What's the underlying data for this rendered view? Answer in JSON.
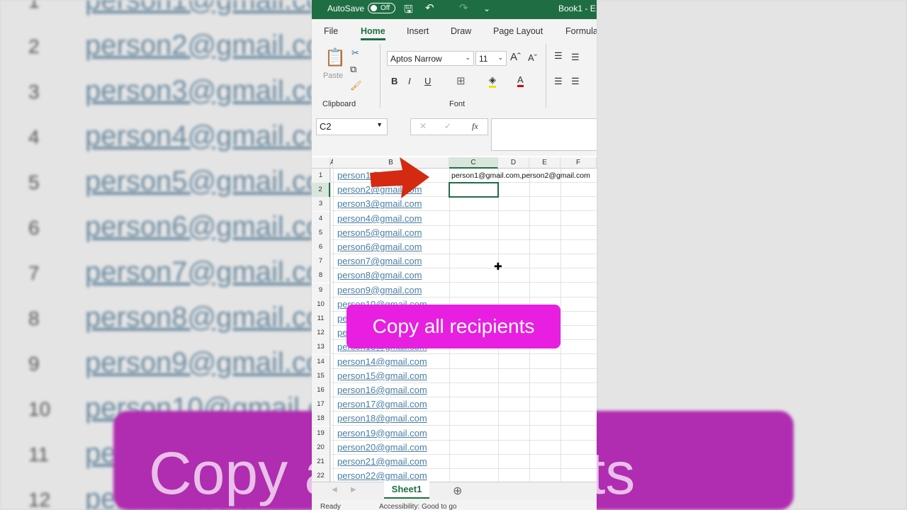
{
  "titlebar": {
    "autosave": "AutoSave",
    "toggle": "Off",
    "title": "Book1  -  E"
  },
  "tabs": [
    "File",
    "Home",
    "Insert",
    "Draw",
    "Page Layout",
    "Formula"
  ],
  "ribbon": {
    "paste": "Paste",
    "font_name": "Aptos Narrow",
    "font_size": "11",
    "clipboard": "Clipboard",
    "font": "Font",
    "bold": "B",
    "italic": "I",
    "underline": "U"
  },
  "formula": {
    "namebox": "C2",
    "fx": "fx",
    "value": ""
  },
  "columns": [
    "A",
    "B",
    "C",
    "D",
    "E",
    "F"
  ],
  "c1_value": "person1@gmail.com,person2@gmail.com",
  "rows": [
    "person1@gmail.com",
    "person2@gmail.com",
    "person3@gmail.com",
    "person4@gmail.com",
    "person5@gmail.com",
    "person6@gmail.com",
    "person7@gmail.com",
    "person8@gmail.com",
    "person9@gmail.com",
    "person10@gmail.com",
    "person11@gmail.com",
    "person12@gmail.com",
    "person13@gmail.com",
    "person14@gmail.com",
    "person15@gmail.com",
    "person16@gmail.com",
    "person17@gmail.com",
    "person18@gmail.com",
    "person19@gmail.com",
    "person20@gmail.com",
    "person21@gmail.com",
    "person22@gmail.com"
  ],
  "sheet_tab": "Sheet1",
  "status": {
    "ready": "Ready",
    "accessibility": "Accessibility: Good to go"
  },
  "overlay": "Copy all recipients",
  "colors": {
    "excel_green": "#1f6e43",
    "overlay": "#e81fe0",
    "arrow": "#d42a12"
  }
}
